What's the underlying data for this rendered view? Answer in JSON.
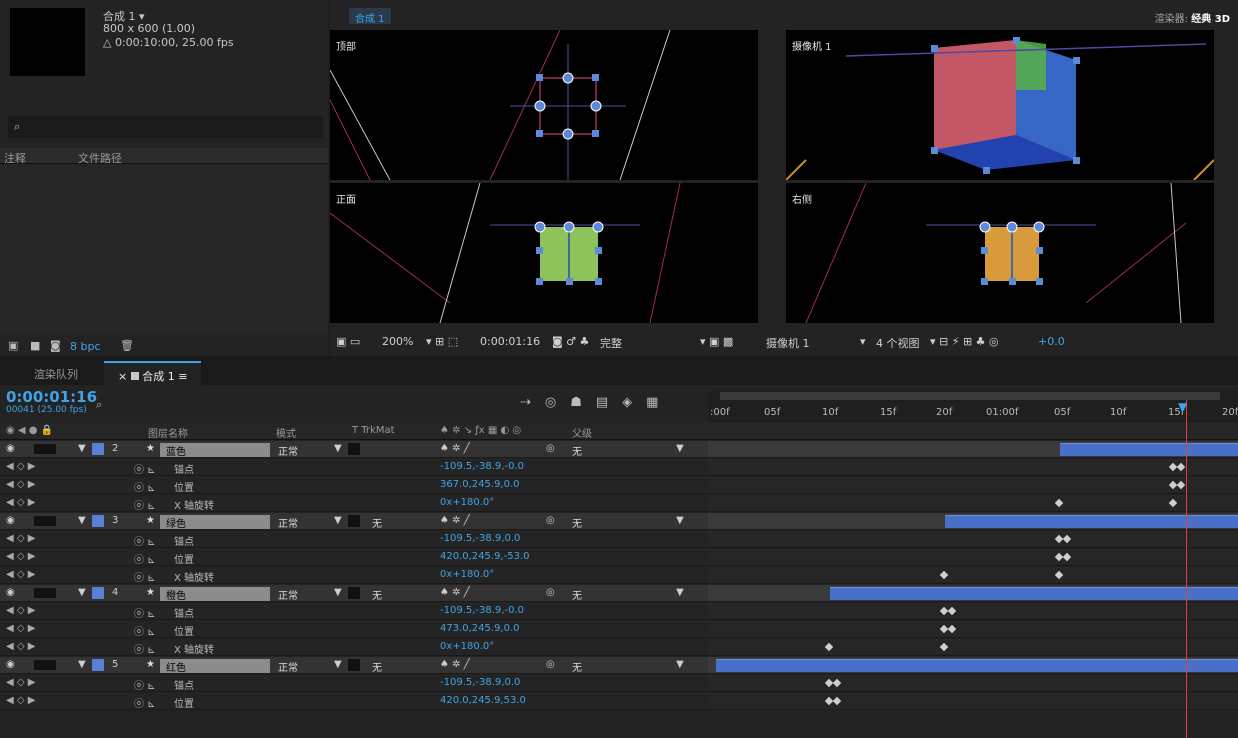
{
  "project": {
    "comp_name": "合成 1 ▾",
    "comp_size": "800 x 600 (1.00)",
    "comp_duration": "△ 0:00:10:00, 25.00 fps",
    "search_icon": "⌕",
    "col_comment": "注释",
    "col_filepath": "文件路径",
    "bpc": "8 bpc"
  },
  "viewer": {
    "tab": "合成 1",
    "renderer_label": "渲染器:",
    "renderer_value": "经典 3D",
    "views": [
      "顶部",
      "摄像机 1",
      "正面",
      "右侧"
    ],
    "zoom": "200%",
    "timecode": "0:00:01:16",
    "quality": "完整",
    "camera": "摄像机 1",
    "layout": "4 个视图",
    "exposure": "+0.0"
  },
  "tabs": {
    "render_queue": "渲染队列",
    "comp": "合成 1"
  },
  "timeline": {
    "time": "0:00:01:16",
    "frames": "00041 (25.00 fps)",
    "col_name": "图层名称",
    "col_mode": "模式",
    "col_trkmat": "T  TrkMat",
    "col_parent": "父级",
    "ruler": [
      ":00f",
      "05f",
      "10f",
      "15f",
      "20f",
      "01:00f",
      "05f",
      "10f",
      "15f",
      "20f"
    ],
    "layers": [
      {
        "num": "2",
        "name": "蓝色",
        "mode": "正常",
        "trk": "",
        "parent": "无",
        "color": "#5a7fd6",
        "props": [
          [
            "锚点",
            "-109.5,-38.9,-0.0"
          ],
          [
            "位置",
            "367.0,245.9,0.0"
          ],
          [
            "X 轴旋转",
            "0x+180.0°"
          ]
        ]
      },
      {
        "num": "3",
        "name": "绿色",
        "mode": "正常",
        "trk": "无",
        "parent": "无",
        "color": "#5a7fd6",
        "props": [
          [
            "锚点",
            "-109.5,-38.9,0.0"
          ],
          [
            "位置",
            "420.0,245.9,-53.0"
          ],
          [
            "X 轴旋转",
            "0x+180.0°"
          ]
        ]
      },
      {
        "num": "4",
        "name": "橙色",
        "mode": "正常",
        "trk": "无",
        "parent": "无",
        "color": "#5a7fd6",
        "props": [
          [
            "锚点",
            "-109.5,-38.9,-0.0"
          ],
          [
            "位置",
            "473.0,245.9,0.0"
          ],
          [
            "X 轴旋转",
            "0x+180.0°"
          ]
        ]
      },
      {
        "num": "5",
        "name": "红色",
        "mode": "正常",
        "trk": "无",
        "parent": "无",
        "color": "#5a7fd6",
        "props": [
          [
            "锚点",
            "-109.5,-38.9,0.0"
          ],
          [
            "位置",
            "420.0,245.9,53.0"
          ]
        ]
      }
    ]
  }
}
